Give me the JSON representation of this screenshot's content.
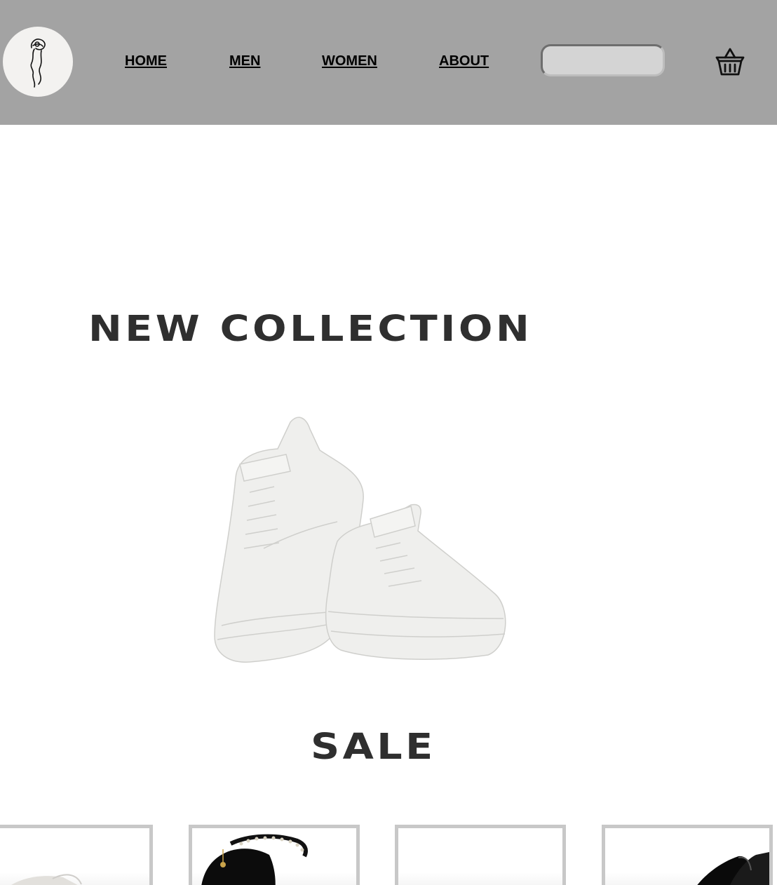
{
  "header": {
    "logo_icon": "woman-silhouette-line-art-icon",
    "nav": [
      {
        "label": "HOME"
      },
      {
        "label": "MEN"
      },
      {
        "label": "WOMEN"
      },
      {
        "label": "ABOUT"
      }
    ],
    "search": {
      "value": "",
      "placeholder": ""
    },
    "cart_icon": "basket-icon",
    "background": "#a3a3a3"
  },
  "hero": {
    "heading": "NEW COLLECTION",
    "image": "white-high-top-sneakers"
  },
  "sale": {
    "heading": "SALE",
    "products": [
      {
        "image": "white-sneakers"
      },
      {
        "image": "black-strappy-heels-with-rhinestone-ankle-strap"
      },
      {
        "image": ""
      },
      {
        "image": "black-patent-pumps"
      }
    ]
  },
  "colors": {
    "heading": "#2f2f2f",
    "card_border": "#c8c8c8"
  }
}
